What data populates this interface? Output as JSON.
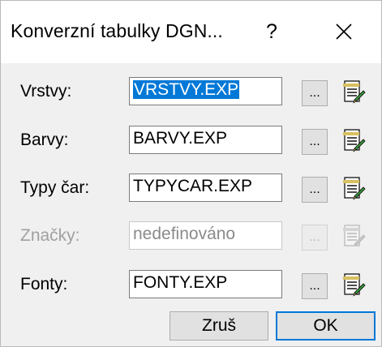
{
  "window": {
    "title": "Konverzní tabulky DGN...",
    "help_label": "?",
    "close_icon": "close-icon"
  },
  "rows": [
    {
      "label": "Vrstvy:",
      "value": "VRSTVY.EXP",
      "enabled": true,
      "selected": true
    },
    {
      "label": "Barvy:",
      "value": "BARVY.EXP",
      "enabled": true,
      "selected": false
    },
    {
      "label": "Typy čar:",
      "value": "TYPYCAR.EXP",
      "enabled": true,
      "selected": false
    },
    {
      "label": "Značky:",
      "value": "nedefinováno",
      "enabled": false,
      "selected": false
    },
    {
      "label": "Fonty:",
      "value": "FONTY.EXP",
      "enabled": true,
      "selected": false
    }
  ],
  "browse_label": "...",
  "edit_icon": "edit-file-icon",
  "buttons": {
    "cancel_label": "Zruš",
    "ok_label": "OK"
  },
  "colors": {
    "selection": "#0078d7",
    "default_button_border": "#0078d7",
    "disabled_text": "#a0a0a0"
  }
}
